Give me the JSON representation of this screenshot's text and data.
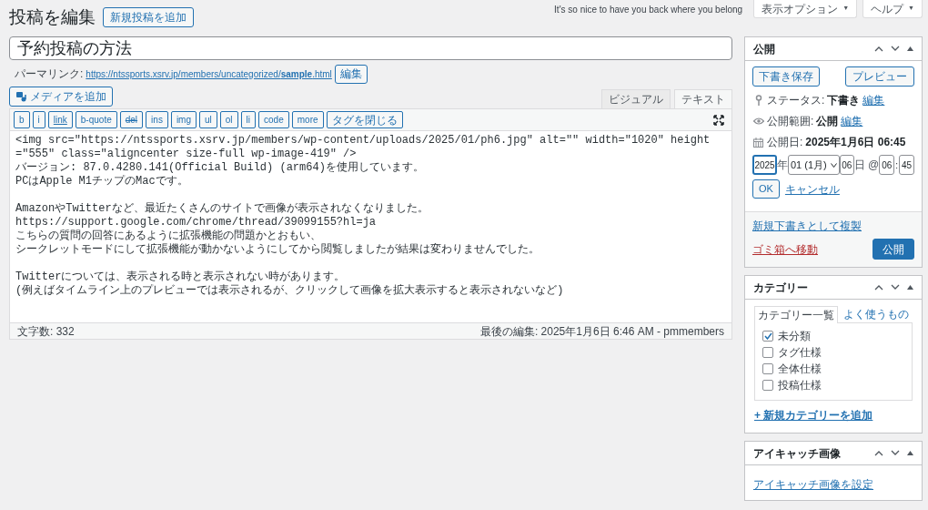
{
  "header": {
    "title": "投稿を編集",
    "add_new": "新規投稿を追加",
    "greeting": "It's so nice to have you back where you belong",
    "buttons": [
      {
        "label": "表示オプション",
        "caret": "▼"
      },
      {
        "label": "ヘルプ",
        "caret": "▼"
      }
    ]
  },
  "post": {
    "title": "予約投稿の方法",
    "permalink_label": "パーマリンク:",
    "permalink_prefix": "https://ntssports.xsrv.jp/members/uncategorized/",
    "permalink_slug": "sample",
    "permalink_suffix": ".html",
    "permalink_edit": "編集"
  },
  "editor": {
    "add_media": "メディアを追加",
    "tabs": [
      {
        "label": "ビジュアル",
        "selected": false
      },
      {
        "label": "テキスト",
        "selected": true
      }
    ],
    "quicktags": [
      {
        "label": "b",
        "kind": "plain"
      },
      {
        "label": "i",
        "kind": "plain"
      },
      {
        "label": "link",
        "kind": "underline"
      },
      {
        "label": "b-quote",
        "kind": "plain"
      },
      {
        "label": "del",
        "kind": "strike"
      },
      {
        "label": "ins",
        "kind": "plain"
      },
      {
        "label": "img",
        "kind": "plain"
      },
      {
        "label": "ul",
        "kind": "plain"
      },
      {
        "label": "ol",
        "kind": "plain"
      },
      {
        "label": "li",
        "kind": "plain"
      },
      {
        "label": "code",
        "kind": "plain"
      },
      {
        "label": "more",
        "kind": "plain"
      },
      {
        "label": "タグを閉じる",
        "kind": "plain"
      }
    ],
    "paragraphs": [
      [
        "<img src=\"https://ntssports.xsrv.jp/members/wp-content/uploads/2025/01/ph6.jpg\" alt=\"\" width=\"1020\" height=\"555\" class=\"aligncenter size-full wp-image-419\" />",
        "バージョン: 87.0.4280.141(Official Build) (arm64)を使用しています。",
        "PCはApple M1チップのMacです。"
      ],
      [
        "AmazonやTwitterなど、最近たくさんのサイトで画像が表示されなくなりました。",
        "https://support.google.com/chrome/thread/39099155?hl=ja",
        "こちらの質問の回答にあるように拡張機能の問題かとおもい、",
        "シークレットモードにして拡張機能が動かないようにしてから閲覧しましたが結果は変わりませんでした。"
      ],
      [
        "Twitterについては、表示される時と表示されない時があります。",
        "(例えばタイムライン上のプレビューでは表示されるが、クリックして画像を拡大表示すると表示されないなど)"
      ]
    ],
    "word_count": "文字数: 332",
    "last_edit": "最後の編集: 2025年1月6日 6:46 AM - pmmembers"
  },
  "publish": {
    "title": "公開",
    "save_draft": "下書き保存",
    "preview": "プレビュー",
    "rows": [
      {
        "kind": "status",
        "label": "ステータス:",
        "value": "下書き",
        "link": "編集"
      },
      {
        "kind": "visibility",
        "label": "公開範囲:",
        "value": "公開",
        "link": "編集"
      },
      {
        "kind": "date",
        "label": "公開日:",
        "value": "2025年1月6日 06:45"
      }
    ],
    "date_fields": {
      "year": "2025",
      "year_unit": "年",
      "month": "01 (1月)",
      "day": "06",
      "day_unit": "日 @",
      "hour": "06",
      "sep": ":",
      "minute": "45"
    },
    "ok": "OK",
    "cancel": "キャンセル",
    "duplicate": "新規下書きとして複製",
    "trash": "ゴミ箱へ移動",
    "publish": "公開"
  },
  "categories": {
    "title": "カテゴリー",
    "tabs": [
      {
        "label": "カテゴリー一覧",
        "selected": true
      },
      {
        "label": "よく使うもの",
        "selected": false
      }
    ],
    "items": [
      {
        "label": "未分類",
        "checked": true
      },
      {
        "label": "タグ仕様",
        "checked": false
      },
      {
        "label": "全体仕様",
        "checked": false
      },
      {
        "label": "投稿仕様",
        "checked": false
      }
    ],
    "add_new": "+ 新規カテゴリーを追加"
  },
  "featured_image": {
    "title": "アイキャッチ画像",
    "set_link": "アイキャッチ画像を設定"
  }
}
